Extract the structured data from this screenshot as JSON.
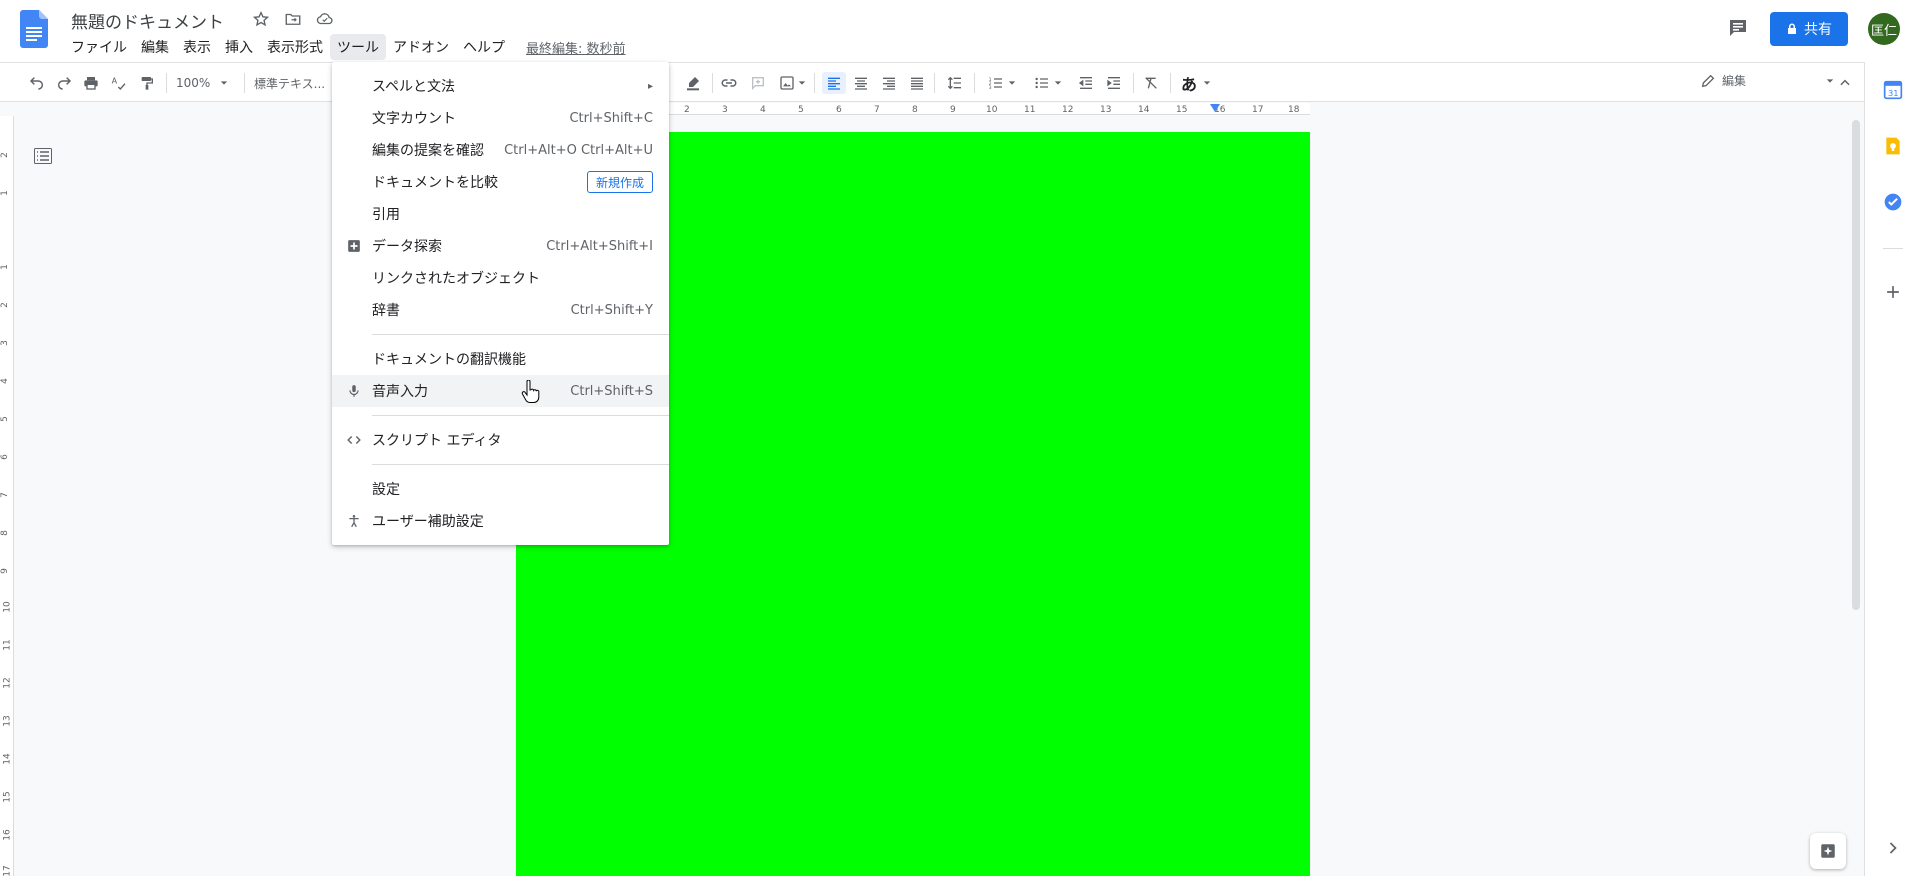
{
  "header": {
    "title": "無題のドキュメント",
    "menus": [
      {
        "name": "file",
        "label": "ファイル"
      },
      {
        "name": "edit",
        "label": "編集"
      },
      {
        "name": "view",
        "label": "表示"
      },
      {
        "name": "insert",
        "label": "挿入"
      },
      {
        "name": "format",
        "label": "表示形式"
      },
      {
        "name": "tools",
        "label": "ツール"
      },
      {
        "name": "addons",
        "label": "アドオン"
      },
      {
        "name": "help",
        "label": "ヘルプ"
      }
    ],
    "last_edit": "最終編集: 数秒前",
    "share_label": "共有",
    "avatar_text": "匡仁"
  },
  "toolbar": {
    "zoom": "100%",
    "style": "標準テキス...",
    "input_tool": "あ",
    "mode_label": "編集"
  },
  "ruler": {
    "h_ticks": [
      "2",
      "3",
      "4",
      "5",
      "6",
      "7",
      "8",
      "9",
      "10",
      "11",
      "12",
      "13",
      "14",
      "15",
      "16",
      "17",
      "18"
    ],
    "v_ticks": [
      "2",
      "1",
      "1",
      "2",
      "3",
      "4",
      "5",
      "6",
      "7",
      "8",
      "9",
      "10",
      "11",
      "12",
      "13",
      "14",
      "15",
      "16",
      "17"
    ]
  },
  "tools_menu": {
    "items": [
      {
        "label": "スペルと文法",
        "shortcut": "",
        "arrow": "▸",
        "icon": ""
      },
      {
        "label": "文字カウント",
        "shortcut": "Ctrl+Shift+C",
        "icon": ""
      },
      {
        "label": "編集の提案を確認",
        "shortcut": "Ctrl+Alt+O Ctrl+Alt+U",
        "icon": ""
      },
      {
        "label": "ドキュメントを比較",
        "badge": "新規作成",
        "icon": ""
      },
      {
        "label": "引用",
        "shortcut": "",
        "icon": ""
      },
      {
        "label": "データ探索",
        "shortcut": "Ctrl+Alt+Shift+I",
        "icon": "explore-icon"
      },
      {
        "label": "リンクされたオブジェクト",
        "shortcut": "",
        "icon": ""
      },
      {
        "label": "辞書",
        "shortcut": "Ctrl+Shift+Y",
        "icon": ""
      },
      {
        "label": "ドキュメントの翻訳機能",
        "shortcut": "",
        "icon": ""
      },
      {
        "label": "音声入力",
        "shortcut": "Ctrl+Shift+S",
        "icon": "microphone-icon"
      },
      {
        "label": "スクリプト エディタ",
        "shortcut": "",
        "icon": "code-icon"
      },
      {
        "label": "設定",
        "shortcut": "",
        "icon": ""
      },
      {
        "label": "ユーザー補助設定",
        "shortcut": "",
        "icon": "accessibility-icon"
      }
    ]
  },
  "colors": {
    "accent": "#1a73e8",
    "page_fill": "#00ff00",
    "avatar": "#33691e"
  }
}
